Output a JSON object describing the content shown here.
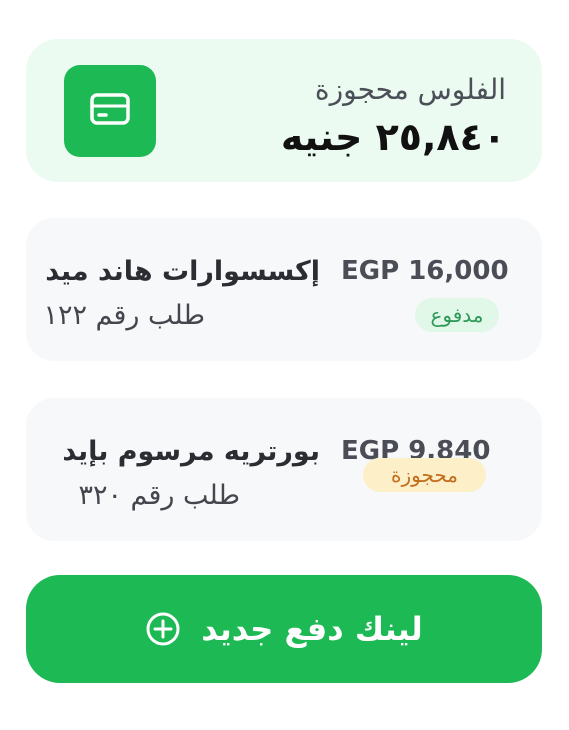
{
  "summary": {
    "label": "الفلوس محجوزة",
    "amount": "٢٥,٨٤٠ جنيه",
    "icon": "credit-card-icon"
  },
  "orders": [
    {
      "title": "إكسسوارات هاند ميد",
      "order_number": "طلب رقم ١٢٢",
      "price": "EGP 16,000",
      "status": "مدفوع"
    },
    {
      "title": "بورتريه مرسوم بإيد",
      "order_number": "طلب رقم ٣٢٠",
      "price": "EGP 9,840",
      "status": "محجوزة"
    }
  ],
  "cta": {
    "label": "لينك دفع جديد",
    "icon": "plus-circle-icon"
  },
  "colors": {
    "brand_green": "#1db954",
    "summary_bg": "#ecfbf1",
    "card_bg": "#f7f8fa",
    "paid_badge_bg": "#e1f7e8",
    "paid_badge_text": "#2f9a57",
    "reserved_badge_bg": "#fdf0c8",
    "reserved_badge_text": "#c26d1c"
  }
}
